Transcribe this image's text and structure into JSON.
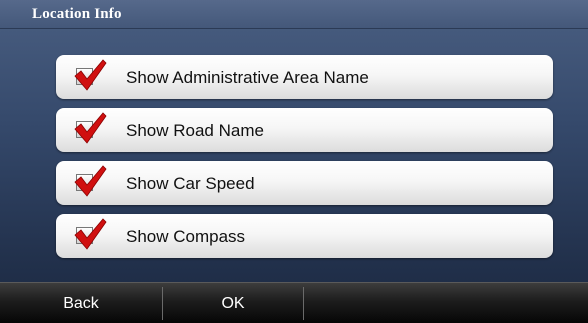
{
  "title_bar": {
    "title": "Location Info"
  },
  "options": [
    {
      "label": "Show Administrative Area Name",
      "checked": true
    },
    {
      "label": "Show Road Name",
      "checked": true
    },
    {
      "label": "Show Car Speed",
      "checked": true
    },
    {
      "label": "Show Compass",
      "checked": true
    }
  ],
  "bottom_bar": {
    "back_label": "Back",
    "ok_label": "OK"
  },
  "colors": {
    "check_mark": "#d01010",
    "background": "#34486a"
  }
}
